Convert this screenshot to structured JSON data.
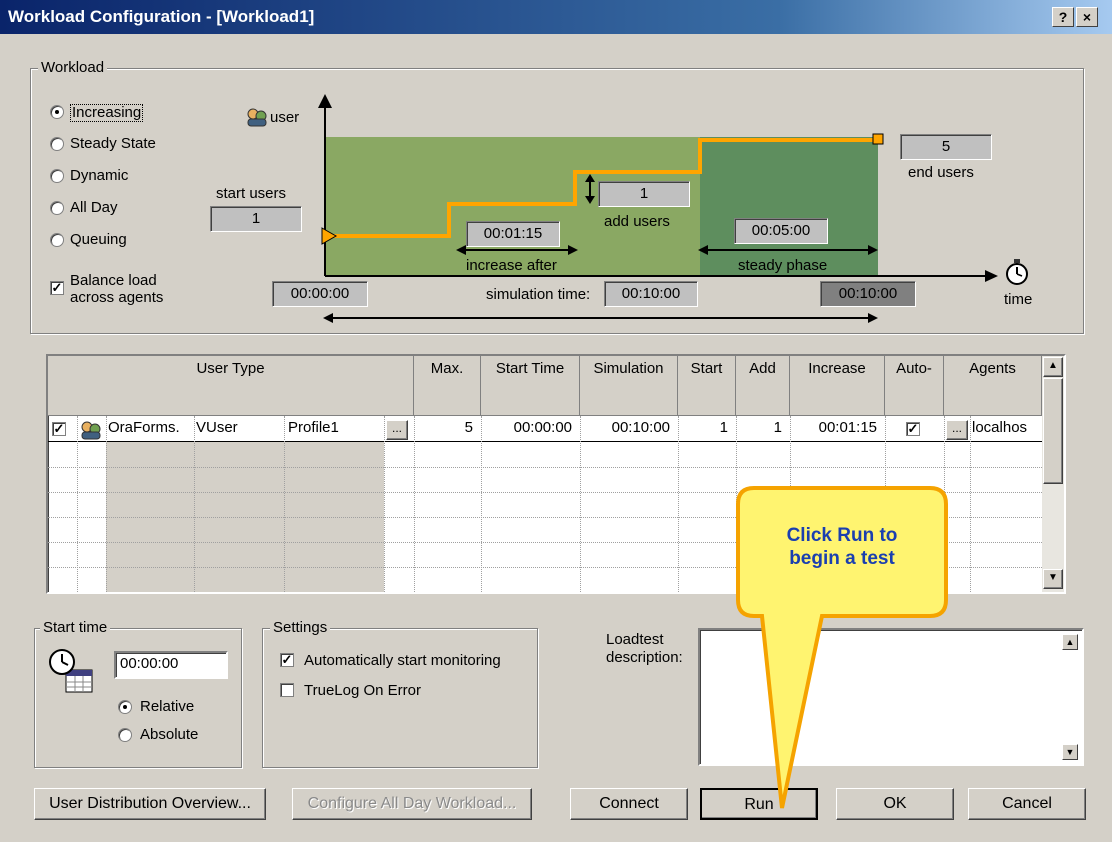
{
  "window": {
    "title": "Workload Configuration - [Workload1]",
    "help_label": "?",
    "close_label": "×"
  },
  "workload": {
    "legend": "Workload",
    "modes": [
      {
        "label": "Increasing",
        "selected": true
      },
      {
        "label": "Steady State",
        "selected": false
      },
      {
        "label": "Dynamic",
        "selected": false
      },
      {
        "label": "All Day",
        "selected": false
      },
      {
        "label": "Queuing",
        "selected": false
      }
    ],
    "balance_line1": "Balance load",
    "balance_line2": "across agents",
    "balance_checked": true
  },
  "chart": {
    "user_axis": "user",
    "time_axis": "time",
    "start_users_label": "start users",
    "start_users_value": "1",
    "end_users_value": "5",
    "end_users_label": "end users",
    "add_users_value": "1",
    "add_users_label": "add users",
    "increase_after_value": "00:01:15",
    "increase_after_label": "increase after",
    "steady_phase_value": "00:05:00",
    "steady_phase_label": "steady phase",
    "start_time_value": "00:00:00",
    "simulation_time_label": "simulation time:",
    "simulation_time_value": "00:10:00",
    "end_time_value": "00:10:00",
    "colors": {
      "ramp_area": "#8aa863",
      "steady_area": "#5e8e5e",
      "line": "#ffa500"
    }
  },
  "table": {
    "headers": [
      "User Type",
      "Max.",
      "Start Time",
      "Simulation",
      "Start",
      "Add",
      "Increase",
      "Auto-",
      "Agents"
    ],
    "row": {
      "checked": true,
      "project": "OraForms.",
      "script": "VUser",
      "profile": "Profile1",
      "dots": "...",
      "max": "5",
      "start_time": "00:00:00",
      "simulation": "00:10:00",
      "start": "1",
      "add": "1",
      "increase": "00:01:15",
      "auto_checked": true,
      "agents": "localhos"
    }
  },
  "callout": {
    "line1": "Click Run to",
    "line2": "begin a test"
  },
  "start_time": {
    "legend": "Start time",
    "value": "00:00:00",
    "relative": "Relative",
    "absolute": "Absolute",
    "selected": "Relative"
  },
  "settings": {
    "legend": "Settings",
    "auto_monitor": "Automatically start monitoring",
    "auto_monitor_checked": true,
    "truelog": "TrueLog On Error",
    "truelog_checked": false
  },
  "description": {
    "label_line1": "Loadtest",
    "label_line2": "description:",
    "value": ""
  },
  "buttons": {
    "user_distribution": "User Distribution Overview...",
    "configure_all_day": "Configure All Day Workload...",
    "connect": "Connect",
    "run": "Run",
    "ok": "OK",
    "cancel": "Cancel"
  }
}
